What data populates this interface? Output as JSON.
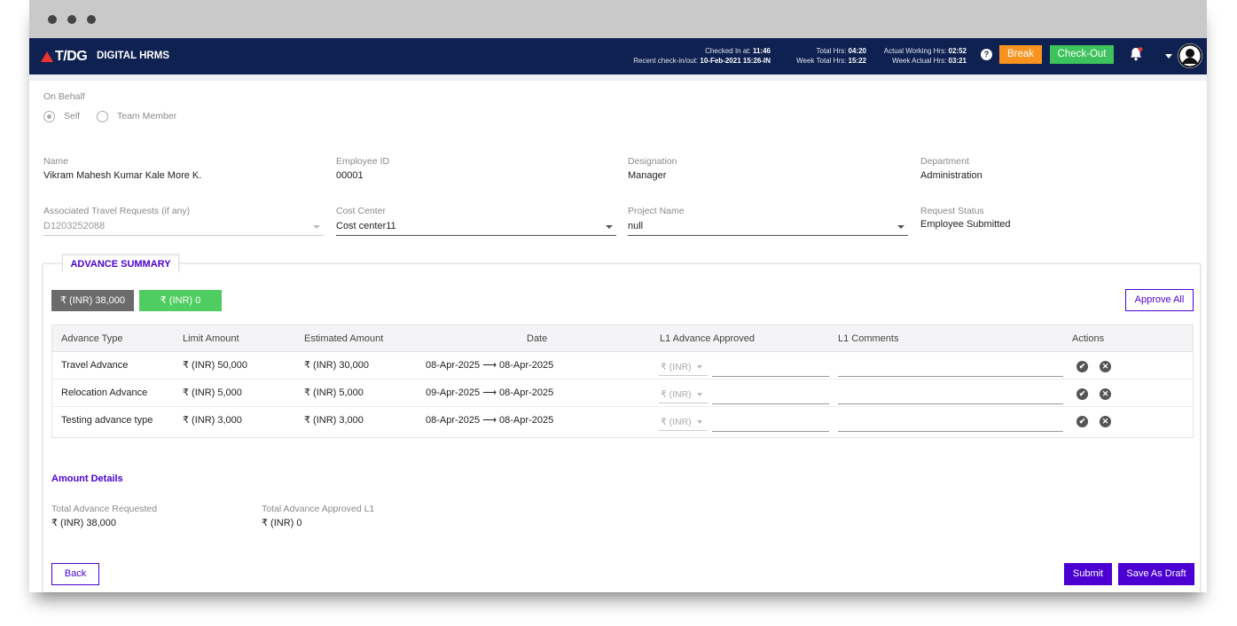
{
  "app": {
    "logo": "T/DG",
    "name": "DIGITAL HRMS"
  },
  "header": {
    "checked_in_label": "Checked In at:",
    "checked_in_value": "11:46",
    "recent_label": "Recent check-in/out:",
    "recent_value": "10-Feb-2021 15:26-IN",
    "total_hrs_label": "Total Hrs:",
    "total_hrs_value": "04:20",
    "week_total_label": "Week Total Hrs:",
    "week_total_value": "15:22",
    "actual_label": "Actual Working Hrs:",
    "actual_value": "02:52",
    "week_actual_label": "Week Actual Hrs:",
    "week_actual_value": "03:21",
    "help_glyph": "?",
    "break_label": "Break",
    "checkout_label": "Check-Out"
  },
  "on_behalf": {
    "label": "On Behalf",
    "options": [
      "Self",
      "Team Member"
    ],
    "selected": "Self"
  },
  "fields": {
    "name_label": "Name",
    "name_value": "Vikram Mahesh Kumar Kale More K.",
    "empid_label": "Employee ID",
    "empid_value": "00001",
    "designation_label": "Designation",
    "designation_value": "Manager",
    "department_label": "Department",
    "department_value": "Administration",
    "travel_label": "Associated Travel Requests (if any)",
    "travel_value": "D1203252088",
    "cost_label": "Cost Center",
    "cost_value": "Cost center11",
    "project_label": "Project Name",
    "project_value": "null",
    "status_label": "Request Status",
    "status_value": "Employee Submitted"
  },
  "summary": {
    "tab_label": "ADVANCE SUMMARY",
    "total_pill": "₹ (INR) 38,000",
    "approved_pill": "₹ (INR) 0",
    "approve_all_label": "Approve All",
    "columns": [
      "Advance Type",
      "Limit Amount",
      "Estimated Amount",
      "Date",
      "L1 Advance Approved",
      "L1 Comments",
      "Actions"
    ],
    "rows": [
      {
        "type": "Travel Advance",
        "limit": "₹ (INR) 50,000",
        "estimated": "₹ (INR) 30,000",
        "date": "08-Apr-2025 ⟶ 08-Apr-2025",
        "currency": "₹ (INR)"
      },
      {
        "type": "Relocation Advance",
        "limit": "₹ (INR) 5,000",
        "estimated": "₹ (INR) 5,000",
        "date": "09-Apr-2025 ⟶ 08-Apr-2025",
        "currency": "₹ (INR)"
      },
      {
        "type": "Testing advance type",
        "limit": "₹ (INR) 3,000",
        "estimated": "₹ (INR) 3,000",
        "date": "08-Apr-2025 ⟶ 08-Apr-2025",
        "currency": "₹ (INR)"
      }
    ],
    "approve_icon": "✔",
    "reject_icon": "✕"
  },
  "amount_details": {
    "title": "Amount Details",
    "requested_label": "Total Advance Requested",
    "requested_value": "₹ (INR) 38,000",
    "approved_label": "Total Advance Approved L1",
    "approved_value": "₹ (INR) 0"
  },
  "footer": {
    "back_label": "Back",
    "submit_label": "Submit",
    "draft_label": "Save As Draft"
  },
  "colors": {
    "navbar": "#0f2150",
    "accent": "#4b00d1",
    "break": "#f7931e",
    "checkout": "#3cc35b"
  }
}
